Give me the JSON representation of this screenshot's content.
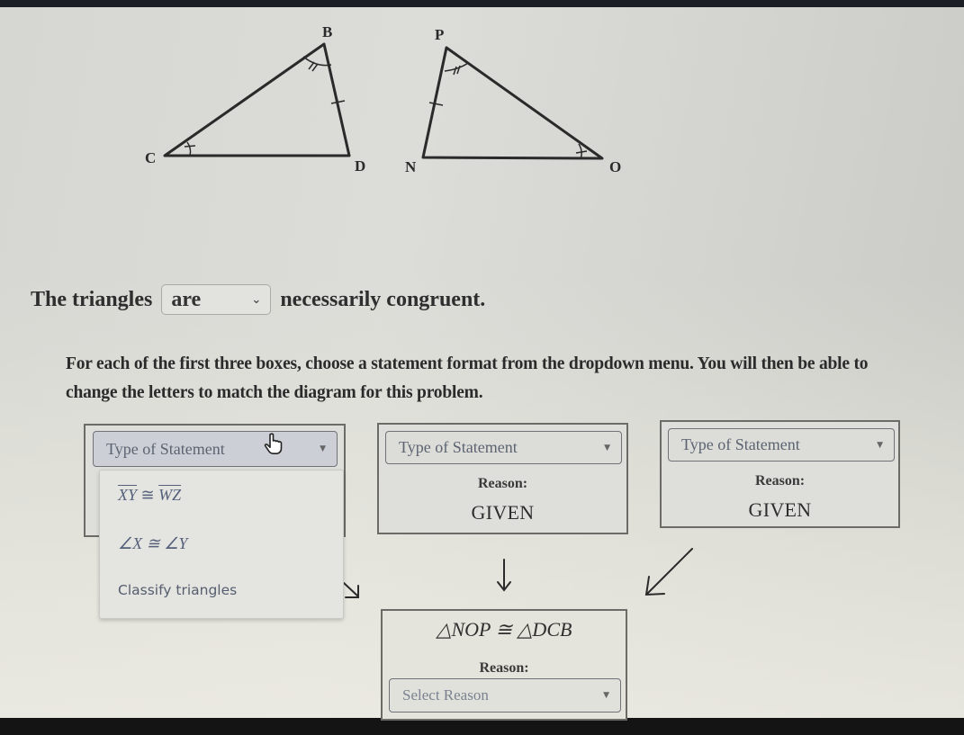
{
  "diagram": {
    "triangle_left": {
      "vertices": [
        "B",
        "C",
        "D"
      ]
    },
    "triangle_right": {
      "vertices": [
        "P",
        "N",
        "O"
      ]
    }
  },
  "congruence_sentence": {
    "prefix": "The triangles",
    "selected": "are",
    "suffix": "necessarily congruent.",
    "chevron_icon": "chevron-down-icon"
  },
  "instructions": "For each of the first three boxes, choose a statement format from the dropdown menu. You will then be able to change the letters to match the diagram for this problem.",
  "boxes": [
    {
      "select_label": "Type of Statement",
      "state": "open"
    },
    {
      "select_label": "Type of Statement",
      "reason_label": "Reason:",
      "reason_value": "GIVEN"
    },
    {
      "select_label": "Type of Statement",
      "reason_label": "Reason:",
      "reason_value": "GIVEN"
    }
  ],
  "dropdown_menu": {
    "items": [
      {
        "seg1": "XY",
        "op": "≅",
        "seg2": "WZ",
        "type": "segment"
      },
      {
        "text": "∠X ≅ ∠Y",
        "type": "angle"
      },
      {
        "text": "Classify triangles",
        "type": "classify"
      }
    ]
  },
  "conclusion": {
    "statement": "△NOP ≅ △DCB",
    "reason_label": "Reason:",
    "reason_placeholder": "Select Reason"
  },
  "cursor": "pointer-hand-icon",
  "colors": {
    "select_text": "#5c6472",
    "box_border": "#6b6b68",
    "page_bg": "#d9d9d5"
  }
}
